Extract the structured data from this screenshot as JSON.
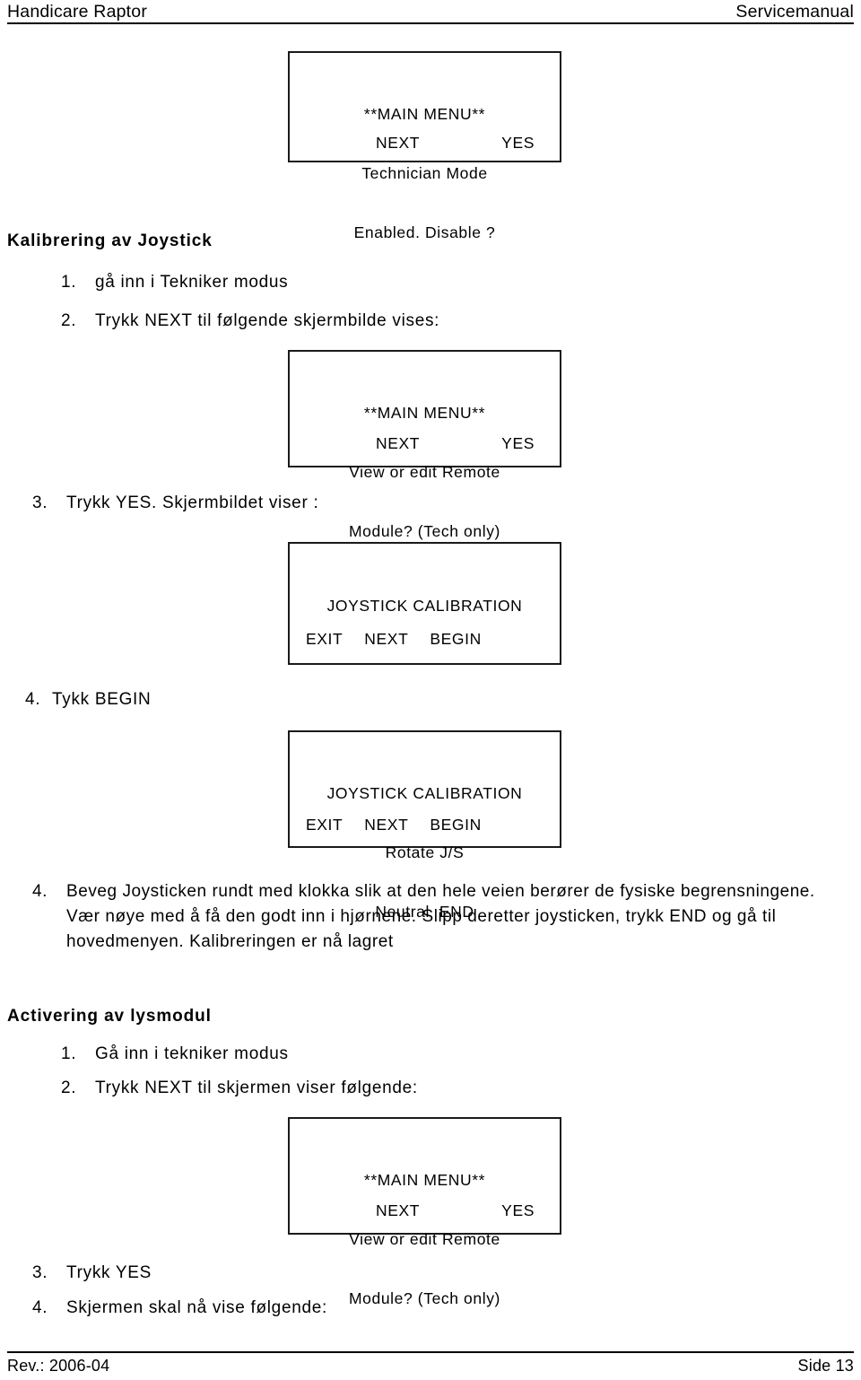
{
  "header": {
    "left": "Handicare Raptor",
    "right": "Servicemanual"
  },
  "footer": {
    "left": "Rev.: 2006-04",
    "right": "Side 13"
  },
  "screens": {
    "technician_mode": {
      "line1": "**MAIN MENU**",
      "line2": "Technician Mode",
      "line3": "Enabled. Disable ?",
      "softkey_left": "NEXT",
      "softkey_right": "YES"
    },
    "remote_module_a": {
      "line1": "**MAIN MENU**",
      "line2": "View or edit Remote",
      "line3": "Module? (Tech only)",
      "softkey_left": "NEXT",
      "softkey_right": "YES"
    },
    "joystick_calibration": {
      "line1": "JOYSTICK CALIBRATION",
      "softkey_exit": "EXIT",
      "softkey_next": "NEXT",
      "softkey_begin": "BEGIN"
    },
    "joystick_rotate": {
      "line1": "JOYSTICK CALIBRATION",
      "line2": "Rotate J/S",
      "line3": "Neutral  END",
      "softkey_exit": "EXIT",
      "softkey_next": "NEXT",
      "softkey_begin": "BEGIN"
    },
    "remote_module_b": {
      "line1": "**MAIN MENU**",
      "line2": "View or edit Remote",
      "line3": "Module? (Tech only)",
      "softkey_left": "NEXT",
      "softkey_right": "YES"
    }
  },
  "sections": {
    "joystick": {
      "title": "Kalibrering av Joystick",
      "steps": [
        {
          "num": "1.",
          "text": "gå inn i Tekniker modus"
        },
        {
          "num": "2.",
          "text": "Trykk NEXT til følgende skjermbilde vises:"
        },
        {
          "num": "3.",
          "text": "Trykk YES. Skjermbildet viser :"
        },
        {
          "num": "4.",
          "text": "Tykk BEGIN"
        }
      ],
      "paragraph": {
        "num": "4.",
        "text": "Beveg Joysticken rundt med klokka slik at den hele veien berører de fysiske begrensningene. Vær nøye med å få den godt inn i hjørnene. Slipp deretter joysticken, trykk END og gå til hovedmenyen. Kalibreringen er nå lagret"
      }
    },
    "lysmodul": {
      "title": "Activering av lysmodul",
      "steps": [
        {
          "num": "1.",
          "text": "Gå inn i tekniker modus"
        },
        {
          "num": "2.",
          "text": "Trykk NEXT til skjermen viser følgende:"
        },
        {
          "num": "3.",
          "text": "Trykk YES"
        },
        {
          "num": "4.",
          "text": "Skjermen skal nå vise følgende:"
        }
      ]
    }
  }
}
